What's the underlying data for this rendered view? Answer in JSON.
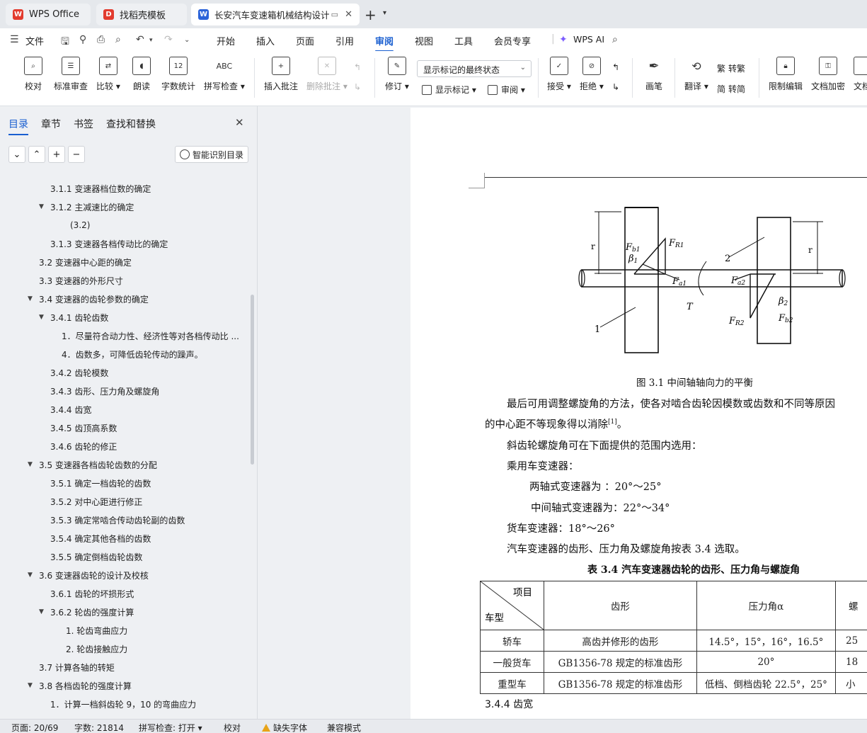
{
  "tabs": [
    {
      "label": "WPS Office",
      "icon": "wps-logo-icon"
    },
    {
      "label": "找稻壳模板",
      "icon": "docer-logo-icon"
    },
    {
      "label": "长安汽车变速箱机械结构设计",
      "icon": "word-doc-icon",
      "active": true
    }
  ],
  "menu": {
    "file": "文件",
    "items": [
      "开始",
      "插入",
      "页面",
      "引用",
      "审阅",
      "视图",
      "工具",
      "会员专享"
    ],
    "active": "审阅",
    "wps_ai": "WPS AI"
  },
  "ribbon": {
    "proofread": "校对",
    "standard_review": "标准审查",
    "compare": "比较",
    "read_aloud": "朗读",
    "word_count": "字数统计",
    "spell_check": "拼写检查",
    "insert_comment": "插入批注",
    "delete_comment": "删除批注",
    "revise": "修订",
    "markup_state": "显示标记的最终状态",
    "show_markup": "显示标记",
    "review_pane": "审阅",
    "accept": "接受",
    "reject": "拒绝",
    "pen": "画笔",
    "translate": "翻译",
    "to_traditional": "转繁",
    "to_simplified": "转简",
    "restrict_edit": "限制编辑",
    "encrypt": "文档加密",
    "doc_rights": "文档"
  },
  "nav": {
    "tabs": [
      "目录",
      "章节",
      "书签",
      "查找和替换"
    ],
    "smart_toc": "智能识别目录",
    "toc": [
      {
        "label": "3.1.1 变速器档位数的确定",
        "level": 2
      },
      {
        "label": "3.1.2 主减速比的确定",
        "level": 2,
        "expanded": true
      },
      {
        "label": "(3.2)",
        "level": 3
      },
      {
        "label": "3.1.3  变速器各档传动比的确定",
        "level": 2
      },
      {
        "label": "3.2 变速器中心距的确定",
        "level": 1
      },
      {
        "label": "3.3 变速器的外形尺寸",
        "level": 1
      },
      {
        "label": "3.4 变速器的齿轮参数的确定",
        "level": 1,
        "expanded": true
      },
      {
        "label": "3.4.1 齿轮齿数",
        "level": 2,
        "expanded": true
      },
      {
        "label": "1．尽量符合动力性、经济性等对各档传动比 ...",
        "level": 3
      },
      {
        "label": "4．齿数多，可降低齿轮传动的躁声。",
        "level": 3
      },
      {
        "label": "3.4.2 齿轮模数",
        "level": 2
      },
      {
        "label": "3.4.3 齿形、压力角及螺旋角",
        "level": 2
      },
      {
        "label": "3.4.4 齿宽",
        "level": 2
      },
      {
        "label": "3.4.5 齿顶高系数",
        "level": 2
      },
      {
        "label": "3.4.6 齿轮的修正",
        "level": 2
      },
      {
        "label": "3.5 变速器各档齿轮齿数的分配",
        "level": 1,
        "expanded": true
      },
      {
        "label": "3.5.1 确定一档齿轮的齿数",
        "level": 2
      },
      {
        "label": "3.5.2 对中心距进行修正",
        "level": 2
      },
      {
        "label": "3.5.3 确定常啮合传动齿轮副的齿数",
        "level": 2
      },
      {
        "label": "3.5.4 确定其他各档的齿数",
        "level": 2
      },
      {
        "label": "3.5.5 确定倒档齿轮齿数",
        "level": 2
      },
      {
        "label": "3.6 变速器齿轮的设计及校核",
        "level": 1,
        "expanded": true
      },
      {
        "label": "3.6.1  齿轮的坏损形式",
        "level": 2
      },
      {
        "label": "3.6.2 轮齿的强度计算",
        "level": 2,
        "expanded": true
      },
      {
        "label": "1. 轮齿弯曲应力",
        "level": 3
      },
      {
        "label": "2. 轮齿接触应力",
        "level": 3
      },
      {
        "label": "3.7 计算各轴的转矩",
        "level": 1
      },
      {
        "label": "3.8 各档齿轮的强度计算",
        "level": 1,
        "expanded": true
      },
      {
        "label": "1．计算一档斜齿轮 9，10 的弯曲应力",
        "level": 2
      }
    ]
  },
  "doc": {
    "figure_labels": {
      "fb1": "F",
      "fb1_sub": "b1",
      "fr1": "F",
      "fr1_sub": "R1",
      "beta1": "β",
      "beta1_sub": "1",
      "fa1": "F",
      "fa1_sub": "a1",
      "n2": "2",
      "fa2": "F",
      "fa2_sub": "a2",
      "beta2": "β",
      "beta2_sub": "2",
      "fr2": "F",
      "fr2_sub": "R2",
      "fb2": "F",
      "fb2_sub": "b2",
      "t": "T",
      "n1": "1"
    },
    "caption": "图 3.1 中间轴轴向力的平衡",
    "para1_line1": "最后可用调整螺旋角的方法，使各对啮合齿轮因模数或齿数和不同等原因",
    "para1_line2": "的中心距不等现象得以消除",
    "para1_ref": "[1]",
    "para1_end": "。",
    "para2": "斜齿轮螺旋角可在下面提供的范围内选用：",
    "para3": "乘用车变速器：",
    "para4": "两轴式变速器为 ：20°～25°",
    "para5": "中间轴式变速器为：22°～34°",
    "para6": "货车变速器：18°～26°",
    "para7": "汽车变速器的齿形、压力角及螺旋角按表 3.4 选取。",
    "table_title": "表 3.4  汽车变速器齿轮的齿形、压力角与螺旋角",
    "table": {
      "corner_top": "项目",
      "corner_bottom": "车型",
      "headers": [
        "齿形",
        "压力角α",
        "螺"
      ],
      "rows": [
        [
          "轿车",
          "高齿并修形的齿形",
          "14.5°，15°，16°，16.5°",
          "25"
        ],
        [
          "一般货车",
          "GB1356-78 规定的标准齿形",
          "20°",
          "18"
        ],
        [
          "重型车",
          "GB1356-78 规定的标准齿形",
          "低档、倒档齿轮 22.5°，25°",
          "小"
        ]
      ]
    },
    "section_heading": "3.4.4 齿宽"
  },
  "status": {
    "page": "页面: 20/69",
    "words": "字数: 21814",
    "spell": "拼写检查: 打开",
    "proof": "校对",
    "missing_font": "缺失字体",
    "compat": "兼容模式"
  }
}
